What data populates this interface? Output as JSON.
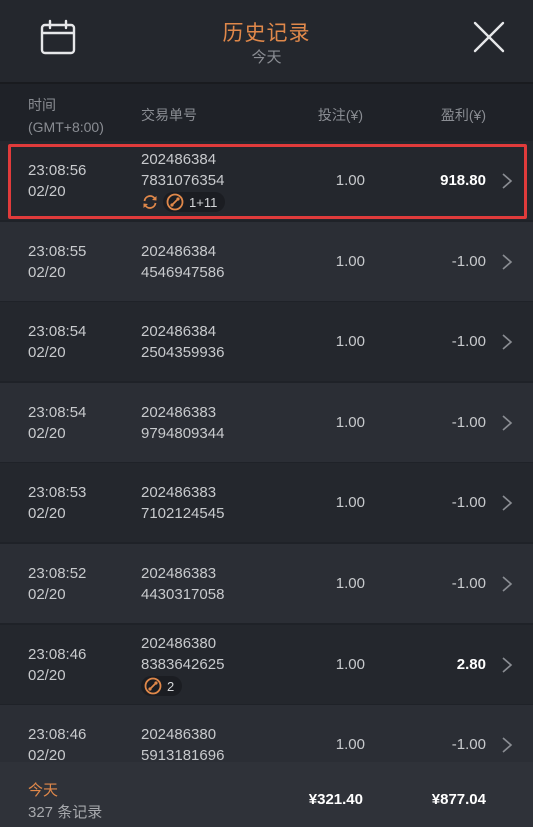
{
  "header": {
    "title": "历史记录",
    "subtitle": "今天",
    "calendar_icon": "calendar-icon",
    "close_icon": "close-icon"
  },
  "columns": {
    "time_line1": "时间",
    "time_line2": "(GMT+8:00)",
    "order": "交易单号",
    "stake": "投注(¥)",
    "profit": "盈利(¥)"
  },
  "rows": [
    {
      "time": "23:08:56",
      "date": "02/20",
      "order1": "202486384",
      "order2": "7831076354",
      "stake": "1.00",
      "profit": "918.80",
      "win": true,
      "badges": {
        "refresh": true,
        "parlay": "1+11"
      }
    },
    {
      "time": "23:08:55",
      "date": "02/20",
      "order1": "202486384",
      "order2": "4546947586",
      "stake": "1.00",
      "profit": "-1.00",
      "win": false
    },
    {
      "time": "23:08:54",
      "date": "02/20",
      "order1": "202486384",
      "order2": "2504359936",
      "stake": "1.00",
      "profit": "-1.00",
      "win": false
    },
    {
      "time": "23:08:54",
      "date": "02/20",
      "order1": "202486383",
      "order2": "9794809344",
      "stake": "1.00",
      "profit": "-1.00",
      "win": false
    },
    {
      "time": "23:08:53",
      "date": "02/20",
      "order1": "202486383",
      "order2": "7102124545",
      "stake": "1.00",
      "profit": "-1.00",
      "win": false
    },
    {
      "time": "23:08:52",
      "date": "02/20",
      "order1": "202486383",
      "order2": "4430317058",
      "stake": "1.00",
      "profit": "-1.00",
      "win": false
    },
    {
      "time": "23:08:46",
      "date": "02/20",
      "order1": "202486380",
      "order2": "8383642625",
      "stake": "1.00",
      "profit": "2.80",
      "win": true,
      "badges": {
        "refresh": false,
        "parlay": "2"
      }
    },
    {
      "time": "23:08:46",
      "date": "02/20",
      "order1": "202486380",
      "order2": "5913181696",
      "stake": "1.00",
      "profit": "-1.00",
      "win": false
    }
  ],
  "footer": {
    "period": "今天",
    "count": "327 条记录",
    "total_stake": "¥321.40",
    "total_profit": "¥877.04"
  },
  "colors": {
    "accent": "#e0884a",
    "highlight": "#e03b3b"
  }
}
